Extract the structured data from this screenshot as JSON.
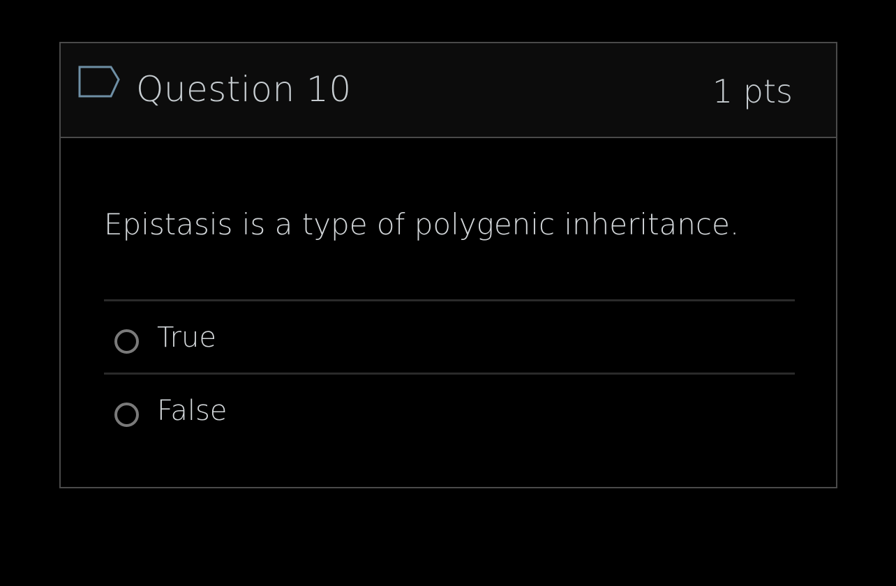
{
  "question": {
    "title": "Question 10",
    "points": "1 pts",
    "flag_icon": "flag-icon",
    "text": "Epistasis is a type of polygenic inheritance."
  },
  "answers": [
    {
      "label": "True",
      "selected": false
    },
    {
      "label": "False",
      "selected": false
    }
  ],
  "colors": {
    "background": "#000000",
    "header_background": "#0c0c0c",
    "border": "#4a4a4a",
    "text": "#d3d7da",
    "flag_outline": "#6e8fa5",
    "radio": "#7a7a7a"
  }
}
